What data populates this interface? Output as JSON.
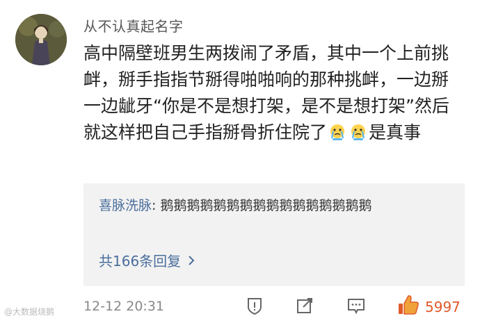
{
  "comment": {
    "username": "从不认真起名字",
    "text_before_emoji": "高中隔壁班男生两拨闹了矛盾，其中一个上前挑衅，掰手指指节掰得啪啪响的那种挑衅，一边掰一边龇牙“你是不是想打架，是不是想打架”然后就这样把自己手指掰骨折住院了",
    "text_after_emoji": "是真事",
    "emoji_icons": [
      "crying-face-icon",
      "crying-face-icon"
    ]
  },
  "reply": {
    "username": "喜脉洗脉",
    "separator": ":",
    "text": " 鹅鹅鹅鹅鹅鹅鹅鹅鹅鹅鹅鹅鹅鹅鹅鹅",
    "more_label": "共166条回复"
  },
  "footer": {
    "timestamp": "12-12 20:31",
    "like_count": "5997",
    "watermark": "@大数据烧鹅"
  },
  "colors": {
    "link": "#4a6e9c",
    "like": "#e05a2b",
    "reply_bg": "#f2f2f2"
  }
}
